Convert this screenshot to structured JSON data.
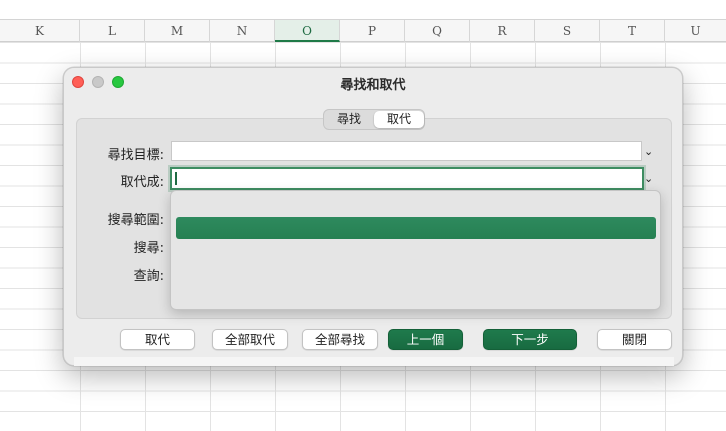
{
  "sheet": {
    "columns": [
      "K",
      "L",
      "M",
      "N",
      "O",
      "P",
      "Q",
      "R",
      "S",
      "T",
      "U"
    ],
    "active_column": "O"
  },
  "dialog": {
    "title": "尋找和取代",
    "tabs": {
      "find": "尋找",
      "replace": "取代"
    },
    "active_tab": "取代",
    "labels": {
      "find_what": "尋找目標:",
      "replace_with": "取代成:",
      "search_scope": "搜尋範圍:",
      "search": "搜尋:",
      "look_in": "查詢:"
    },
    "find_value": "",
    "replace_value": "",
    "buttons": {
      "replace": "取代",
      "replace_all": "全部取代",
      "find_all": "全部尋找",
      "previous": "上一個",
      "next": "下一步",
      "close": "關閉"
    },
    "accent_color": "#1f7a4c"
  },
  "icons": {
    "close": "window-close-icon",
    "minimize": "window-minimize-icon",
    "maximize": "window-maximize-icon",
    "chevron": "chevron-down-icon"
  }
}
